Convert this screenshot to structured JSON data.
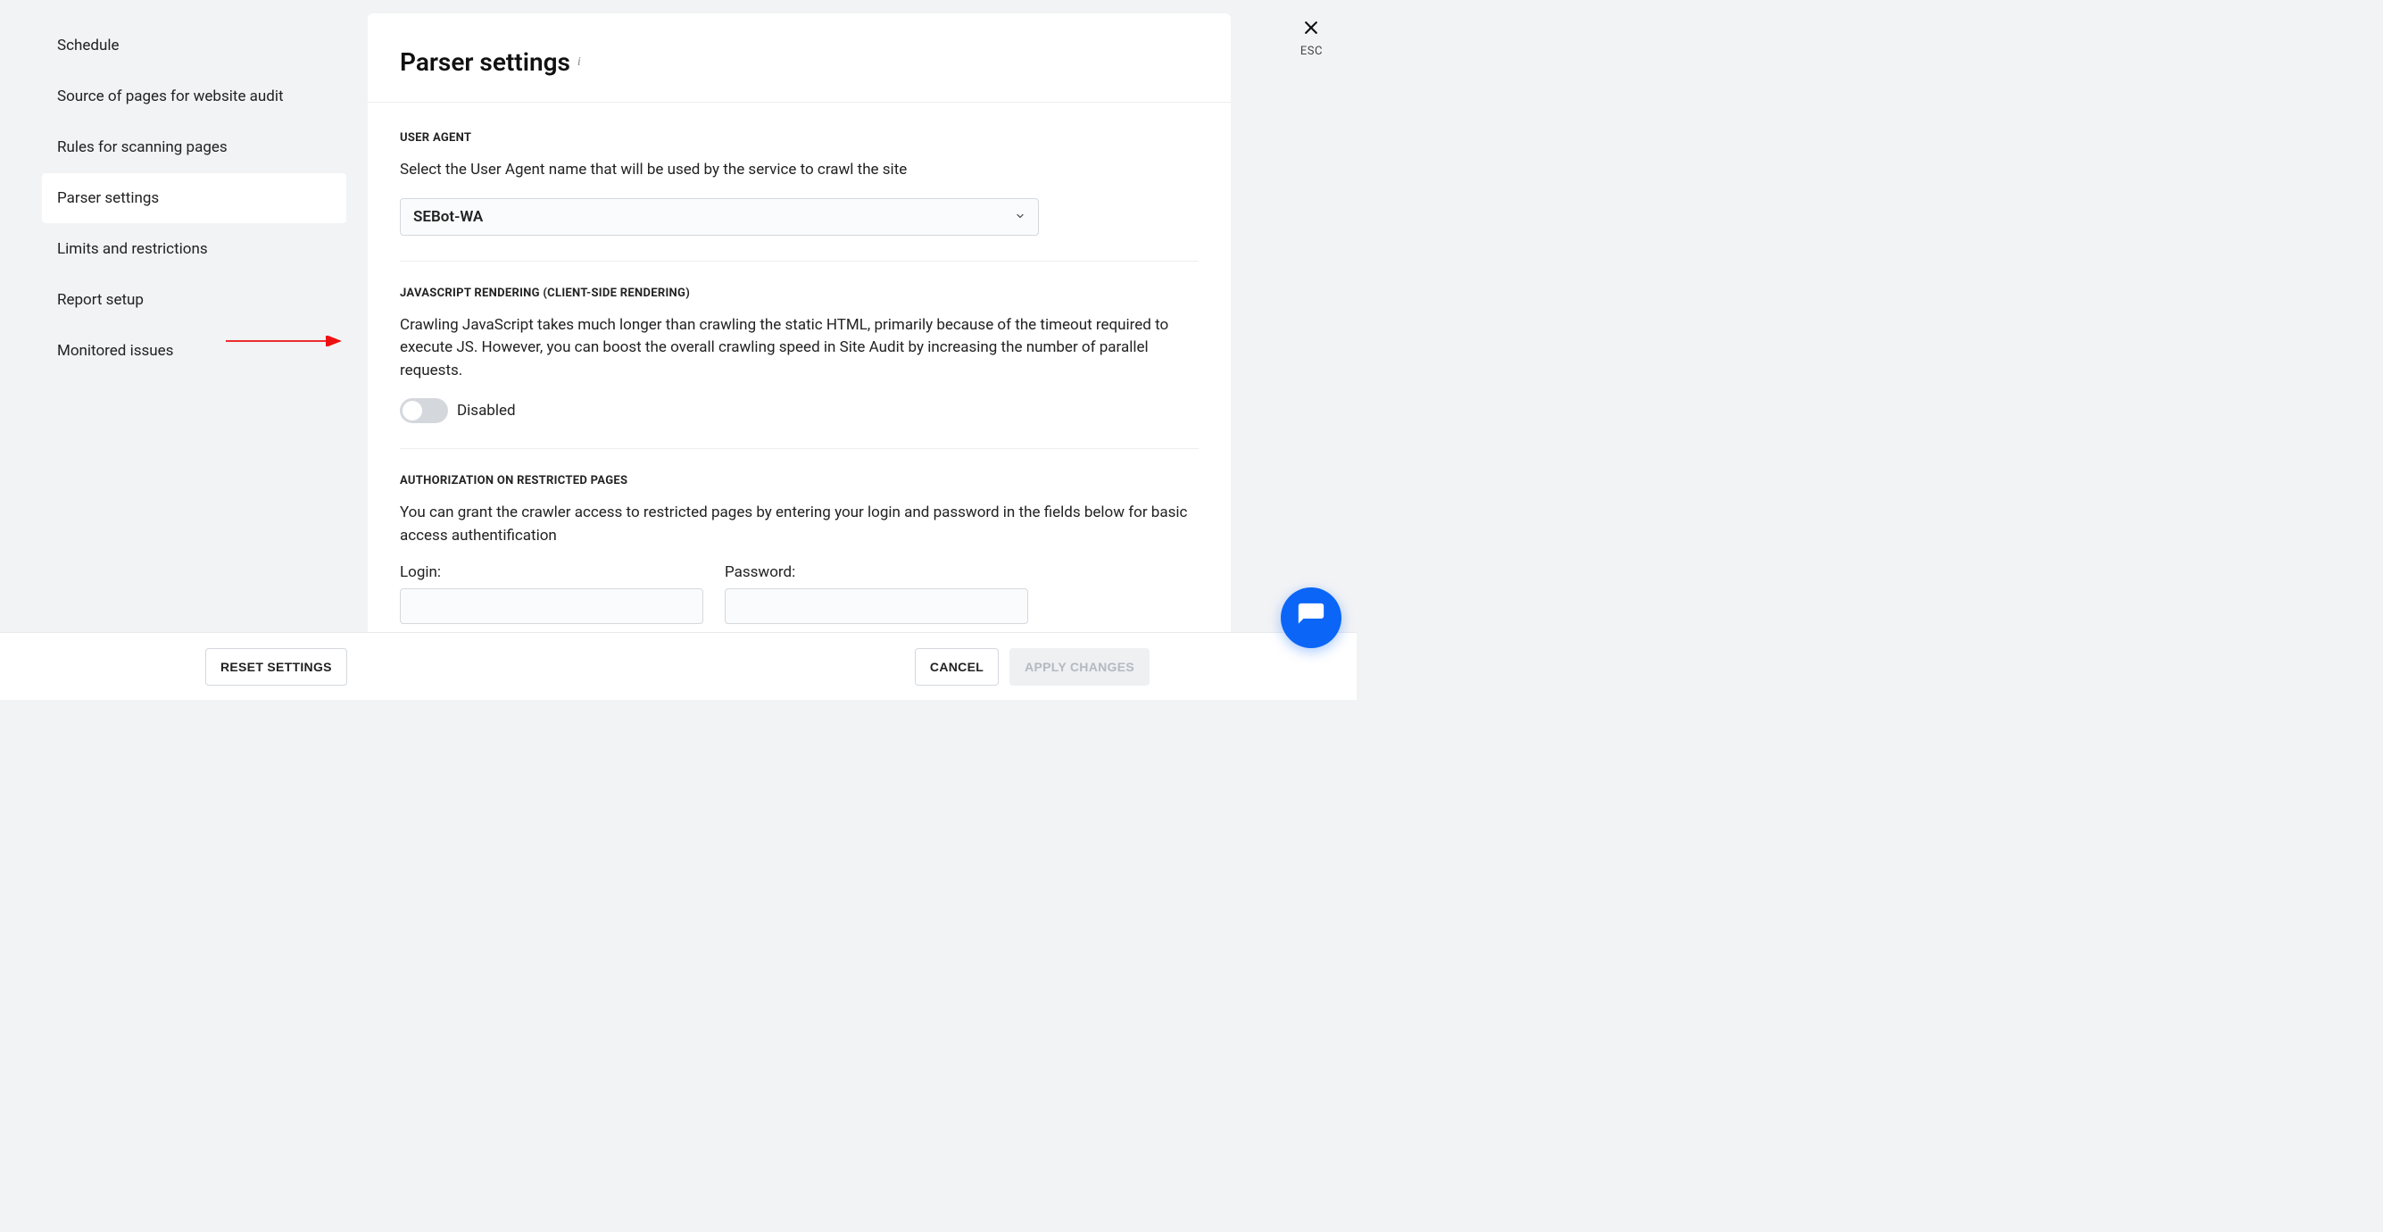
{
  "close": {
    "label": "ESC"
  },
  "sidebar": {
    "items": [
      {
        "label": "Schedule"
      },
      {
        "label": "Source of pages for website audit"
      },
      {
        "label": "Rules for scanning pages"
      },
      {
        "label": "Parser settings"
      },
      {
        "label": "Limits and restrictions"
      },
      {
        "label": "Report setup"
      },
      {
        "label": "Monitored issues"
      }
    ]
  },
  "content": {
    "title": "Parser settings",
    "info_glyph": "i",
    "sections": {
      "user_agent": {
        "label": "USER AGENT",
        "desc": "Select the User Agent name that will be used by the service to crawl the site",
        "selected": "SEBot-WA"
      },
      "js_render": {
        "label": "JAVASCRIPT RENDERING (CLIENT-SIDE RENDERING)",
        "desc": "Crawling JavaScript takes much longer than crawling the static HTML, primarily because of the timeout required to execute JS. However, you can boost the overall crawling speed in Site Audit by increasing the number of parallel requests.",
        "toggle_label": "Disabled"
      },
      "auth": {
        "label": "AUTHORIZATION ON RESTRICTED PAGES",
        "desc": "You can grant the crawler access to restricted pages by entering your login and password in the fields below for basic access authentification",
        "login_label": "Login:",
        "password_label": "Password:",
        "login_value": "",
        "password_value": ""
      }
    }
  },
  "footer": {
    "reset": "RESET SETTINGS",
    "cancel": "CANCEL",
    "apply": "APPLY CHANGES"
  }
}
